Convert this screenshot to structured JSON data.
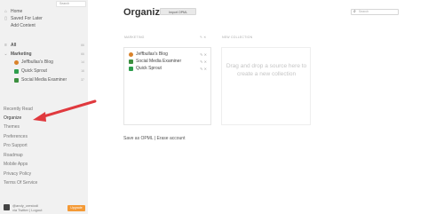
{
  "sidebar": {
    "search_placeholder": "Search",
    "top_items": [
      {
        "label": "Home"
      },
      {
        "label": "Saved For Later"
      },
      {
        "label": "Add Content"
      }
    ],
    "all": {
      "label": "All",
      "count": "66"
    },
    "marketing": {
      "label": "Marketing",
      "count": "66"
    },
    "feeds": [
      {
        "label": "Jeffbullas's Blog",
        "count": "14",
        "color": "#d9822b"
      },
      {
        "label": "Quick Sprout",
        "count": "16",
        "color": "#2e9e4d"
      },
      {
        "label": "Social Media Examiner",
        "count": "37",
        "color": "#3c8f3f"
      }
    ],
    "links": [
      "Recently Read",
      "Organize",
      "Themes",
      "Preferences",
      "Pro Support",
      "Roadmap",
      "Mobile Apps",
      "Privacy Policy",
      "Terms Of Service"
    ],
    "user": {
      "line1": "@andy_crestodi",
      "line2": "via Twitter | Logout",
      "upgrade_label": "Upgrade"
    }
  },
  "main": {
    "title": "Organize",
    "import_label": "Import OPML",
    "search_placeholder": "Search",
    "marketing_label": "MARKETING",
    "marketing_actions": "✎ ✕",
    "collection_label": "NEW COLLECTION",
    "feeds": [
      {
        "label": "Jeffbullas's Blog",
        "color": "#d9822b"
      },
      {
        "label": "Social Media Examiner",
        "color": "#3c8f3f"
      },
      {
        "label": "Quick Sprout",
        "color": "#2e9e4d"
      }
    ],
    "row_actions": "✎ ✕",
    "placeholder": "Drag and drop a source here to create a new collection",
    "save_line": "Save as OPML | Erase account"
  },
  "colors": {
    "upgrade": "#f49a36",
    "arrow": "#e0393e",
    "sidebar_bg": "#f1f1f1"
  }
}
